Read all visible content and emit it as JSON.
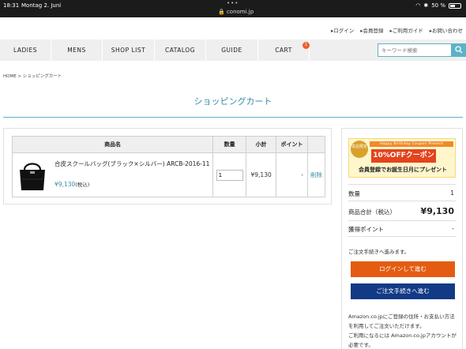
{
  "statusbar": {
    "time": "18:31",
    "date": "Montag 2. Juni",
    "url": "conomi.jp",
    "battery": "50 %",
    "battery_level": 0.5
  },
  "toplinks": [
    "▸ログイン",
    "▸会員登録",
    "▸ご利用ガイド",
    "▸お問い合わせ"
  ],
  "nav": {
    "items": [
      "LADIES",
      "MENS",
      "SHOP LIST",
      "CATALOG",
      "GUIDE",
      "CART"
    ],
    "cart_badge": "1",
    "search_placeholder": "キーワード検索"
  },
  "breadcrumb": "HOME > ショッピングカート",
  "page_title": "ショッピングカート",
  "cart": {
    "headers": [
      "商品名",
      "数量",
      "小計",
      "ポイント",
      ""
    ],
    "item": {
      "name": "合皮スクールバッグ(ブラック×シルバー) ARCB-2016-11",
      "price": "¥9,130",
      "tax_note": "(税込)",
      "quantity": "1",
      "subtotal": "¥9,130",
      "points": "-",
      "delete": "削除"
    }
  },
  "coupon": {
    "stamp": "本店限定",
    "top": "Happy Birthday Coupon Present",
    "ribbon": "10%OFFクーポン",
    "sub": "会員登録でお誕生日月にプレゼント"
  },
  "summary": {
    "qty_label": "数量",
    "qty_value": "1",
    "total_label": "商品合計（税込）",
    "total_value": "¥9,130",
    "points_label": "獲得ポイント",
    "points_value": "-"
  },
  "checkout": {
    "note": "ご注文手続きへ進みます。",
    "login_button": "ログインして進む",
    "proceed_button": "ご注文手続きへ進む",
    "amazon_note1": "Amazon.co.jpにご登録の住所・お支払い方法を利用してご注文いただけます。",
    "amazon_note2": "ご利用になるには Amazon.co.jpアカウントが必要です。"
  },
  "colors": {
    "accent": "#3a8ba8",
    "login_button": "#e45c12",
    "proceed_button": "#123a86"
  }
}
